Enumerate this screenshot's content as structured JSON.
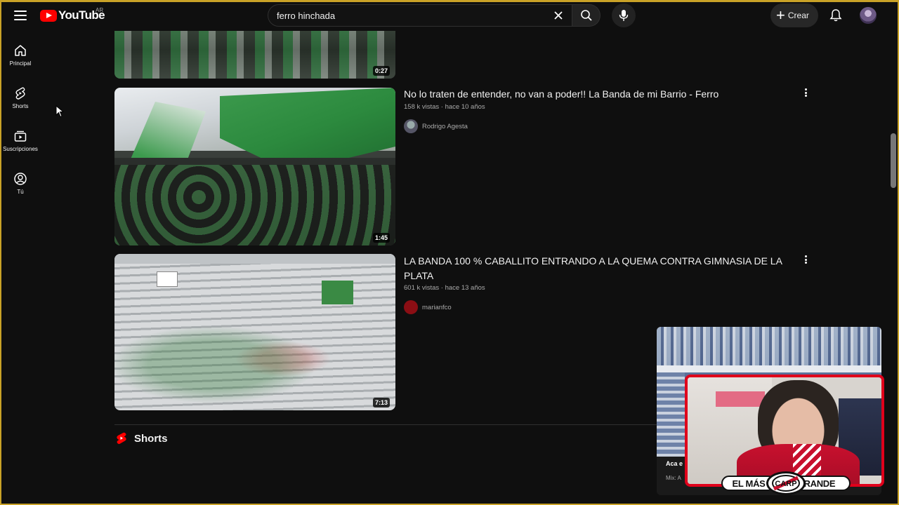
{
  "header": {
    "logo_text": "YouTube",
    "country_code": "AR",
    "search_value": "ferro hinchada",
    "create_label": "Crear"
  },
  "sidebar": {
    "items": [
      {
        "label": "Principal",
        "icon": "home-icon"
      },
      {
        "label": "Shorts",
        "icon": "shorts-icon"
      },
      {
        "label": "Suscripciones",
        "icon": "subscriptions-icon"
      },
      {
        "label": "Tú",
        "icon": "you-icon"
      }
    ]
  },
  "videos": [
    {
      "duration": "0:27"
    },
    {
      "title": "No lo traten de entender, no van a poder!! La Banda de mi Barrio - Ferro",
      "meta": "158 k vistas · hace 10 años",
      "channel": "Rodrigo Agesta",
      "duration": "1:45"
    },
    {
      "title": "LA BANDA 100 % CABALLITO ENTRANDO A LA QUEMA CONTRA GIMNASIA DE LA PLATA",
      "meta": "601 k vistas · hace 13 años",
      "channel": "marianfco",
      "duration": "7:13"
    }
  ],
  "shorts_section": {
    "title": "Shorts"
  },
  "overlay": {
    "mix_title": "Aca e",
    "mix_sub": "Mix: A",
    "banner_left": "EL MÁS",
    "banner_right": "GRANDE"
  },
  "colors": {
    "accent_red": "#ff0000",
    "webcam_border": "#e0001b",
    "ferro_green": "#2e8b3e",
    "frame_gold": "#c9a227"
  }
}
